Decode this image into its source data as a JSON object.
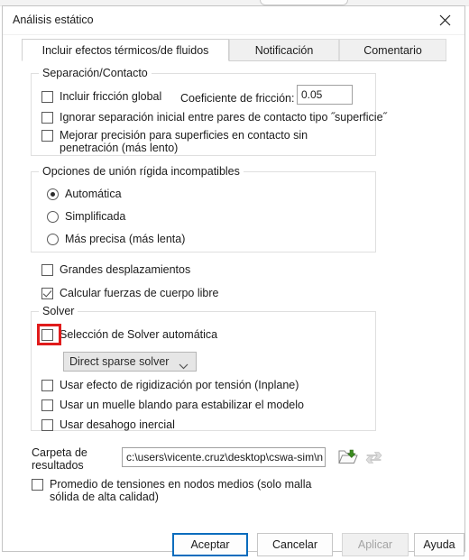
{
  "window": {
    "title": "Análisis estático",
    "close_icon": "close-icon"
  },
  "tabs": [
    {
      "label": "Incluir efectos térmicos/de fluidos",
      "active": true
    },
    {
      "label": "Notificación",
      "active": false
    },
    {
      "label": "Comentario",
      "active": false
    }
  ],
  "separation_group": {
    "legend": "Separación/Contacto",
    "friction_checkbox": {
      "label": "Incluir fricción global",
      "checked": false
    },
    "friction_coefficient_label": "Coeficiente de fricción:",
    "friction_coefficient_value": "0.05",
    "ignore_initial_gap": {
      "label": "Ignorar separación inicial entre pares de contacto tipo ˝superficie˝",
      "checked": false
    },
    "improve_accuracy": {
      "label": "Mejorar precisión para superficies en contacto sin penetración (más lento)",
      "checked": false
    }
  },
  "rigid_group": {
    "legend": "Opciones de unión rígida incompatibles",
    "options": [
      {
        "label": "Automática",
        "selected": true
      },
      {
        "label": "Simplificada",
        "selected": false
      },
      {
        "label": "Más precisa (más lenta)",
        "selected": false
      }
    ]
  },
  "standalone_checkboxes": [
    {
      "label": "Grandes desplazamientos",
      "checked": false
    },
    {
      "label": "Calcular fuerzas de cuerpo libre",
      "checked": true
    }
  ],
  "solver_group": {
    "legend": "Solver",
    "auto_solver": {
      "label": "Selección de Solver automática",
      "checked": false
    },
    "solver_select": {
      "value": "Direct sparse solver",
      "arrow_icon": "chevron-down-icon"
    },
    "options": [
      {
        "label": "Usar efecto de rigidización por tensión (Inplane)",
        "checked": false
      },
      {
        "label": "Usar un muelle blando para estabilizar el modelo",
        "checked": false
      },
      {
        "label": "Usar desahogo inercial",
        "checked": false
      }
    ]
  },
  "results": {
    "label": "Carpeta de resultados",
    "path_value": "c:\\users\\vicente.cruz\\desktop\\cswa-sim\\n",
    "browse_icon": "open-folder-icon",
    "refresh_icon": "refresh-icon",
    "average_stresses": {
      "label": "Promedio de tensiones en nodos medios (solo malla sólida de alta calidad)",
      "checked": false
    }
  },
  "buttons": [
    {
      "label": "Aceptar",
      "state": "default"
    },
    {
      "label": "Cancelar",
      "state": "normal"
    },
    {
      "label": "Aplicar",
      "state": "disabled"
    },
    {
      "label": "Ayuda",
      "state": "normal"
    }
  ],
  "annotation": {
    "target": "auto-solver-checkbox",
    "color": "#e01b1b"
  }
}
